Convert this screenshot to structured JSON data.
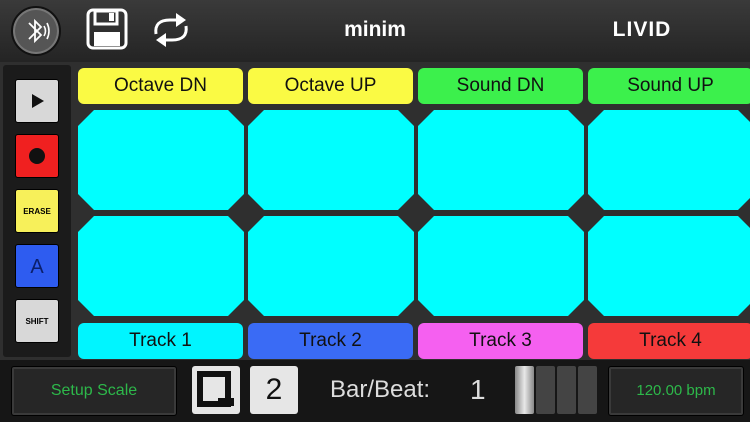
{
  "header": {
    "title": "minim",
    "brand": "LIVID",
    "icons": [
      "bluetooth-icon",
      "save-icon",
      "sync-icon"
    ]
  },
  "sidebar": {
    "play": {
      "icon": "play-icon",
      "color": "#d8d8d8"
    },
    "record": {
      "icon": "record-icon",
      "color": "#f02020"
    },
    "erase": {
      "label": "ERASE",
      "color": "#f7f05a"
    },
    "a_button": {
      "label": "A",
      "color": "#2e5cf0"
    },
    "shift": {
      "label": "SHIFT",
      "color": "#d8d8d8"
    }
  },
  "top_labels": [
    {
      "label": "Octave DN",
      "color": "#fafa44"
    },
    {
      "label": "Octave UP",
      "color": "#fafa44"
    },
    {
      "label": "Sound DN",
      "color": "#3cf04c"
    },
    {
      "label": "Sound UP",
      "color": "#3cf04c"
    }
  ],
  "pad_color": "#00ffff",
  "tracks": [
    {
      "label": "Track 1",
      "color": "#00f5ff"
    },
    {
      "label": "Track 2",
      "color": "#3a6bf5"
    },
    {
      "label": "Track 3",
      "color": "#f560f0"
    },
    {
      "label": "Track 4",
      "color": "#f53a3a"
    }
  ],
  "footer": {
    "setup_scale": "Setup Scale",
    "quantize_icon": "quantize-q-icon",
    "quantize_value": "2",
    "bar_beat_label": "Bar/Beat:",
    "bar_beat_value": "1",
    "beat_meter_active": 1,
    "beat_meter_total": 4,
    "bpm": "120.00 bpm",
    "display_color": "#2db84a"
  }
}
